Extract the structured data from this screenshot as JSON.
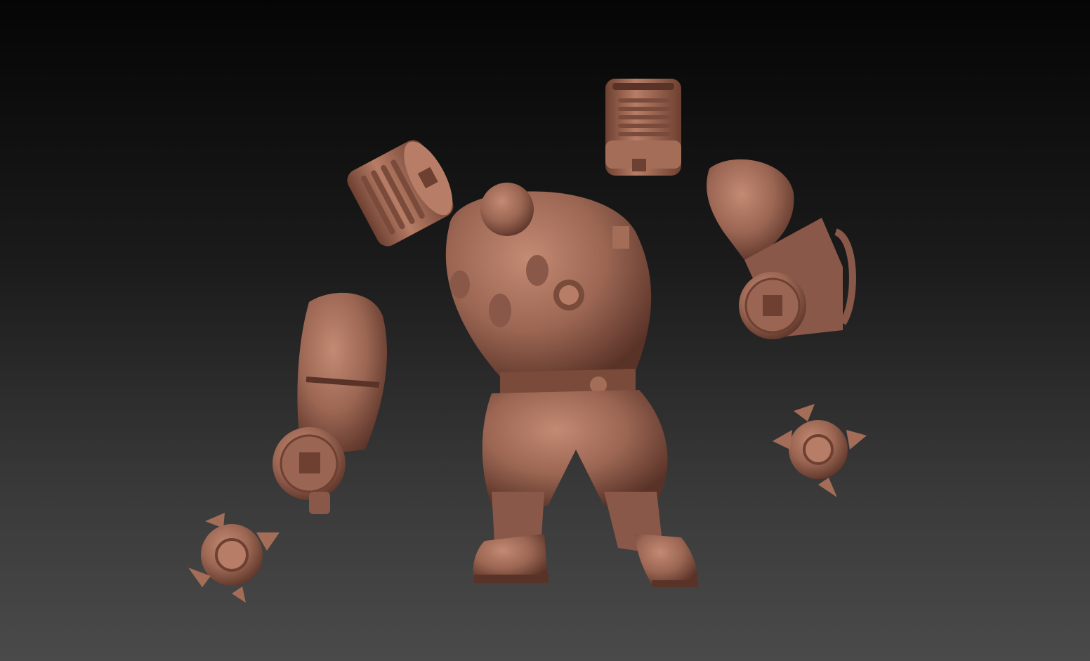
{
  "viewport": {
    "background_top": "#050505",
    "background_bottom": "#4a4a4a"
  },
  "model": {
    "material_color": "#9a6552",
    "material_highlight": "#c48a73",
    "material_shadow": "#5a3328",
    "parts": [
      "torso-with-legs",
      "left-arm-cannon",
      "right-arm-cannon",
      "canister-left",
      "canister-top",
      "claw-piece-left",
      "claw-piece-right"
    ]
  }
}
